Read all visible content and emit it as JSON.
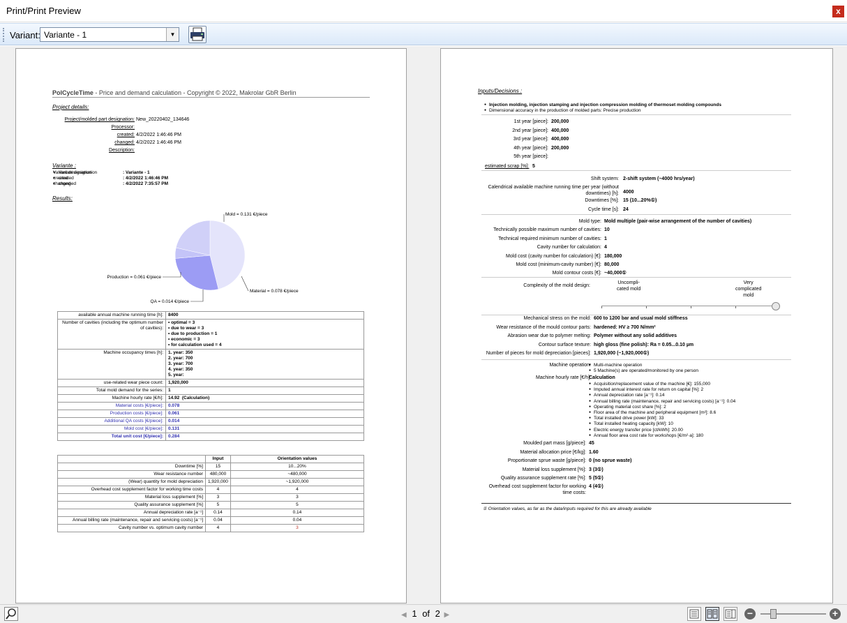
{
  "window": {
    "title": "Print/Print Preview",
    "close": "x"
  },
  "toolbar": {
    "variant_label": "Variant:",
    "variant_value": "Variante - 1"
  },
  "page1": {
    "header_brand": "PolCycleTime",
    "header_rest": " - Price and demand calculation - Copyright © 2022, Makrolar GbR Berlin",
    "project_heading": "Project details:",
    "project_rows": [
      {
        "label": "Project/molded part designation:",
        "value": "New_20220402_134646"
      },
      {
        "label": "Processor:",
        "value": ""
      },
      {
        "label": "created:",
        "value": "4/2/2022 1:46:46 PM"
      },
      {
        "label": "changed:",
        "value": "4/2/2022 1:46:46 PM"
      },
      {
        "label": "Description:",
        "value": ""
      }
    ],
    "variante_heading": "Variante :",
    "variante_rows": [
      {
        "label": "Variant designation",
        "value": ": Variante - 1"
      },
      {
        "label": "created",
        "value": ": 4/2/2022 1:46:46 PM"
      },
      {
        "label": "changed",
        "value": ": 4/2/2022 7:35:57 PM"
      }
    ],
    "results_heading": "Results:",
    "pie_labels": {
      "mold": "Mold = 0.131 €/piece",
      "production": "Production = 0.061 €/piece",
      "material": "Material = 0.078 €/piece",
      "qa": "QA = 0.014 €/piece"
    },
    "results_rows": [
      {
        "label": "available annual machine running time [h]:",
        "value": "8400"
      },
      {
        "label": "Number of cavities (including the optimum number of cavities):",
        "value": "• optimal = 3\n• due to wear = 3\n• due to production = 1\n• economic = 3\n• for calculation used = 4"
      },
      {
        "label": "Machine occupancy times [h]:",
        "value": "1. year: 350\n2. year: 700\n3. year: 700\n4. year: 350\n5. year:"
      },
      {
        "label": "use-related wear piece count:",
        "value": "1,920,000"
      },
      {
        "label": "Total mold demand for the series:",
        "value": "1"
      },
      {
        "label": "Machine hourly rate [€/h]:",
        "value": "14.92  (Calculation)"
      },
      {
        "label": "Material costs [€/piece]:",
        "value": "0.078"
      },
      {
        "label": "Production costs [€/piece]:",
        "value": "0.061"
      },
      {
        "label": "Additional QA costs [€/piece]:",
        "value": "0.014"
      },
      {
        "label": "Mold cost [€/piece]:",
        "value": "0.131"
      },
      {
        "label": "Total unit cost [€/piece]:",
        "value": "0.284"
      }
    ],
    "compare_header": {
      "input": "Input",
      "orient": "Orientation values"
    },
    "compare_rows": [
      {
        "label": "Downtime [%]",
        "input": "15",
        "orient": "10...20%"
      },
      {
        "label": "Wear resistance number",
        "input": "480,000",
        "orient": "~480,000"
      },
      {
        "label": "(Wear) quantity for mold depreciation",
        "input": "1,920,000",
        "orient": "~1,920,000"
      },
      {
        "label": "Overhead cost supplement factor for working time costs",
        "input": "4",
        "orient": "4"
      },
      {
        "label": "Material loss supplement [%]",
        "input": "3",
        "orient": "3"
      },
      {
        "label": "Quality assurance supplement [%]",
        "input": "5",
        "orient": "5"
      },
      {
        "label": "Annual depreciation rate [a⁻¹]",
        "input": "0.14",
        "orient": "0.14"
      },
      {
        "label": "Annual billing rate (maintenance, repair and servicing costs) [a⁻¹]",
        "input": "0.04",
        "orient": "0.04"
      },
      {
        "label": "Cavity number vs. optimum cavity number",
        "input": "4",
        "orient": "3"
      }
    ]
  },
  "page2": {
    "heading": "Inputs/Decisions :",
    "bullets": [
      "Injection molding, injection stamping and injection compression molding of thermoset molding compounds",
      "Dimensional accuracy in the production of molded parts: Precise production"
    ],
    "years": [
      {
        "label": "1st year [piece]:",
        "value": "200,000"
      },
      {
        "label": "2nd year [piece]:",
        "value": "400,000"
      },
      {
        "label": "3rd year [piece]:",
        "value": "400,000"
      },
      {
        "label": "4th year [piece]:",
        "value": "200,000"
      },
      {
        "label": "5th year [piece]:",
        "value": ""
      }
    ],
    "scrap_label": "estimated scrap [%]:",
    "scrap_value": "5",
    "shift_rows": [
      {
        "label": "Shift system:",
        "value": "2-shift system (~4000 hrs/year)"
      },
      {
        "label": "Calendrical available machine running time per year (without downtimes) [h]:",
        "value": "4000"
      },
      {
        "label": "Downtimes [%]:",
        "value": "15 (10...20%①)"
      },
      {
        "label": "Cycle time [s]:",
        "value": "24"
      }
    ],
    "mold_rows": [
      {
        "label": "Mold type:",
        "value": "Mold multiple (pair-wise arrangement of the number of cavities)"
      },
      {
        "label": "Technically possible maximum number of cavities:",
        "value": "10"
      },
      {
        "label": "Technical required minimum number of cavities:",
        "value": "1"
      },
      {
        "label": "Cavity number for calculation:",
        "value": "4"
      },
      {
        "label": "Mold cost (cavity number for calculation) [€]:",
        "value": "180,000"
      },
      {
        "label": "Mold cost (minimum-cavity number) [€]:",
        "value": "80,000"
      },
      {
        "label": "Mold contour costs [€]:",
        "value": "~40,000①"
      }
    ],
    "complexity_label": "Complexity of the mold design:",
    "complexity_left": "Uncompli-\ncated mold",
    "complexity_right": "Very\ncomplicated\nmold",
    "complexity_level": 1.0,
    "stress_rows": [
      {
        "label": "Mechanical stress on the mold:",
        "value": "600 to 1200 bar and usual mold stiffness"
      },
      {
        "label": "Wear resistance of the mould contour parts:",
        "value": "hardened: HV ≥ 700 N/mm²"
      },
      {
        "label": "Abrasion wear due to polymer melting:",
        "value": "Polymer without any solid additives"
      },
      {
        "label": "Contour surface texture:",
        "value": "high gloss (fine polish): Ra = 0.05...0.10 µm"
      },
      {
        "label": "Number of pieces for mold depreciation [pieces]:",
        "value": "1,920,000  (~1,920,000①)"
      }
    ],
    "machine_op_label": "Machine operation:",
    "machine_op_items": [
      "Multi-machine operation",
      "5 Machine(s) are operated/monitored by one person"
    ],
    "hourly_label": "Machine hourly rate [€/h]:",
    "hourly_title": "Calculation",
    "hourly_items": [
      "Acquisition/replacement value of the machine [€]: 155,000",
      "Imputed annual interest rate for return on capital [%]: 2",
      "Annual depreciation rate [a⁻¹]: 0.14",
      "Annual billing rate (maintenance, repair and servicing costs) [a⁻¹]: 0.04",
      "Operating material cost share [%]: 2",
      "Floor area of the machine and peripheral equipment [m²]: 8.6",
      "Total installed drive power [kW]: 33",
      "Total installed heating capacity [kW]: 10",
      "Electric energy transfer price [ct/kWh]: 20.00",
      "Annual floor area cost rate for workshops [€/m²·a]: 180"
    ],
    "tail_rows": [
      {
        "label": "Moulded part mass [g/piece]:",
        "value": "45"
      },
      {
        "label": "Material allocation price [€/kg]:",
        "value": "1.60"
      },
      {
        "label": "Proportionate sprue waste [g/piece]:",
        "value": "0 (no sprue waste)"
      },
      {
        "label": "Material loss supplement [%]:",
        "value": "3 (3①)"
      },
      {
        "label": "Quality assurance supplement rate [%]:",
        "value": "5 (5①)"
      },
      {
        "label": "Overhead cost supplement factor for working time costs:",
        "value": "4 (4①)"
      }
    ],
    "footnote": "① Orientation values, as far as the data/inputs required for this are already available"
  },
  "pager": {
    "current": "1",
    "of": "of",
    "total": "2"
  },
  "chart_data": {
    "type": "pie",
    "categories": [
      "Mold",
      "Material",
      "QA",
      "Production"
    ],
    "values": [
      0.131,
      0.078,
      0.014,
      0.061
    ],
    "colors": [
      "#e4e4fb",
      "#9c9cf4",
      "#c4c4f8",
      "#d0d0f8"
    ],
    "title": ""
  }
}
